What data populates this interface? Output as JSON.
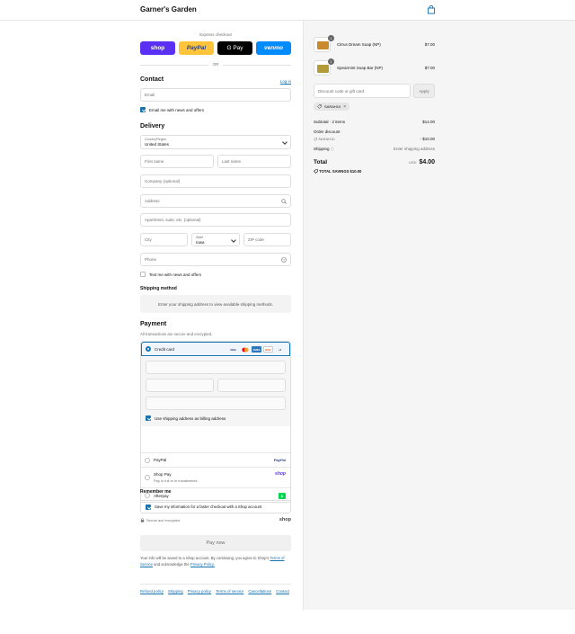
{
  "header": {
    "brand": "Garner's Garden"
  },
  "express": {
    "label": "Express checkout",
    "buttons": [
      "shop",
      "PayPal",
      "G Pay",
      "venmo"
    ],
    "or": "OR"
  },
  "contact": {
    "title": "Contact",
    "login": "Log in",
    "email_placeholder": "Email",
    "news_label": "Email me with news and offers"
  },
  "delivery": {
    "title": "Delivery",
    "country_label": "Country/Region",
    "country_value": "United States",
    "first_name": "First name",
    "last_name": "Last name",
    "company": "Company (optional)",
    "address": "Address",
    "apartment": "Apartment, suite, etc. (optional)",
    "city": "City",
    "state_label": "State",
    "state_value": "Iowa",
    "zip": "ZIP code",
    "phone": "Phone",
    "text_label": "Text me with news and offers"
  },
  "shipping": {
    "title": "Shipping method",
    "notice": "Enter your shipping address to view available shipping methods."
  },
  "payment": {
    "title": "Payment",
    "subtitle": "All transactions are secure and encrypted.",
    "credit_card": "Credit card",
    "cards": [
      "VISA",
      "MC",
      "AMEX",
      "DISC"
    ],
    "more_cards": "+4",
    "billing_label": "Use shipping address as billing address",
    "paypal": "PayPal",
    "paypal_logo": "PayPal",
    "shoppay": "Shop Pay",
    "shoppay_sub": "Pay in full or in installments",
    "shoppay_logo": "shop",
    "afterpay": "Afterpay",
    "afterpay_logo": "$"
  },
  "remember": {
    "title": "Remember me",
    "save_label": "Save my information for a faster checkout with a Shop account",
    "secure": "Secure and encrypted",
    "shop": "shop"
  },
  "paynow": "Pay now",
  "legal": {
    "text": "Your info will be saved to a Shop account. By continuing, you agree to Shop's",
    "tos": "Terms of Service",
    "and": "and acknowledge the",
    "privacy": "Privacy Policy."
  },
  "footer": [
    "Refund policy",
    "Shipping",
    "Privacy policy",
    "Terms of service",
    "Cancellations",
    "Contact"
  ],
  "summary": {
    "items": [
      {
        "qty": "1",
        "name": "Citrus Dream Soap (NP)",
        "price": "$7.00",
        "color": "#c98a2e"
      },
      {
        "qty": "1",
        "name": "Spearmint Soap Bar (NP)",
        "price": "$7.00",
        "color": "#b59a3a"
      }
    ],
    "discount_placeholder": "Discount code or gift card",
    "apply": "Apply",
    "tag": "SARAH10",
    "subtotal_label": "Subtotal · 2 items",
    "subtotal_value": "$14.00",
    "order_discount": "Order discount",
    "code": "SARAH10",
    "code_value": "- $10.00",
    "shipping_label": "Shipping",
    "shipping_value": "Enter shipping address",
    "total_label": "Total",
    "currency": "USD",
    "total_value": "$4.00",
    "savings_label": "TOTAL SAVINGS",
    "savings_value": "$10.00"
  }
}
